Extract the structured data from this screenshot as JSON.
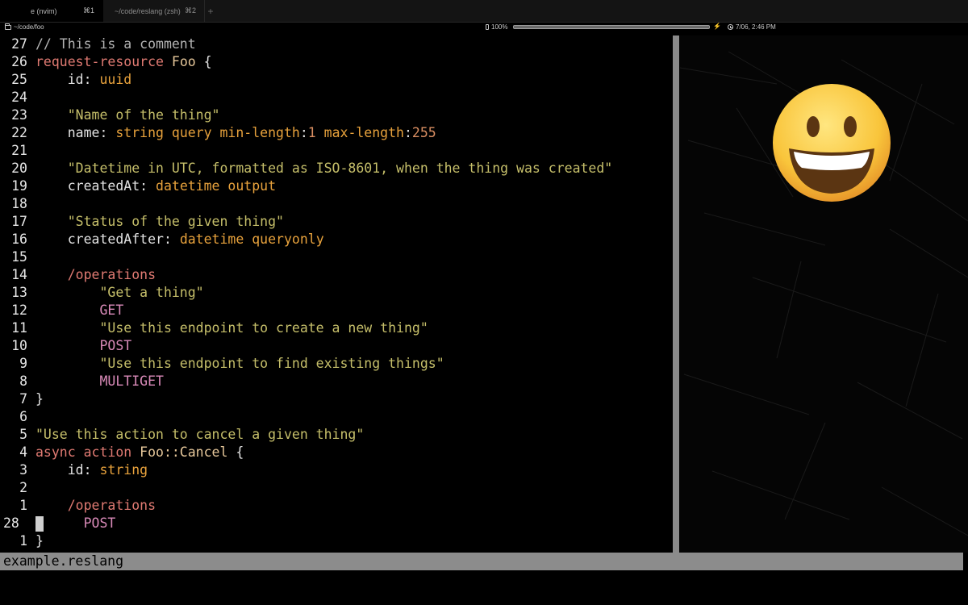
{
  "tabs": [
    {
      "title": "e (nvim)",
      "shortcut": "⌘1",
      "active": true
    },
    {
      "title": "~/code/reslang (zsh)",
      "shortcut": "⌘2",
      "active": false
    }
  ],
  "statusline": {
    "path": "~/code/foo",
    "battery": "100%",
    "battery_level": 1.0,
    "clock": "7/06, 2:46 PM"
  },
  "editor": {
    "filename": "example.reslang",
    "lines": [
      {
        "num": "27",
        "tokens": [
          {
            "t": "cmt",
            "v": "// This is a comment"
          }
        ]
      },
      {
        "num": "26",
        "tokens": [
          {
            "t": "kw",
            "v": "request-resource "
          },
          {
            "t": "name",
            "v": "Foo "
          },
          {
            "t": "punc",
            "v": "{"
          }
        ]
      },
      {
        "num": "25",
        "tokens": [
          {
            "t": "id",
            "v": "    id: "
          },
          {
            "t": "type",
            "v": "uuid"
          }
        ]
      },
      {
        "num": "24",
        "tokens": []
      },
      {
        "num": "23",
        "tokens": [
          {
            "t": "str",
            "v": "    \"Name of the thing\""
          }
        ]
      },
      {
        "num": "22",
        "tokens": [
          {
            "t": "id",
            "v": "    name: "
          },
          {
            "t": "type",
            "v": "string query min-length"
          },
          {
            "t": "id",
            "v": ":"
          },
          {
            "t": "num",
            "v": "1 "
          },
          {
            "t": "type",
            "v": "max-length"
          },
          {
            "t": "id",
            "v": ":"
          },
          {
            "t": "num",
            "v": "255"
          }
        ]
      },
      {
        "num": "21",
        "tokens": []
      },
      {
        "num": "20",
        "tokens": [
          {
            "t": "str",
            "v": "    \"Datetime in UTC, formatted as ISO-8601, when the thing was created\""
          }
        ]
      },
      {
        "num": "19",
        "tokens": [
          {
            "t": "id",
            "v": "    createdAt: "
          },
          {
            "t": "type",
            "v": "datetime output"
          }
        ]
      },
      {
        "num": "18",
        "tokens": []
      },
      {
        "num": "17",
        "tokens": [
          {
            "t": "str",
            "v": "    \"Status of the given thing\""
          }
        ]
      },
      {
        "num": "16",
        "tokens": [
          {
            "t": "id",
            "v": "    createdAfter: "
          },
          {
            "t": "type",
            "v": "datetime queryonly"
          }
        ]
      },
      {
        "num": "15",
        "tokens": []
      },
      {
        "num": "14",
        "tokens": [
          {
            "t": "path",
            "v": "    /operations"
          }
        ]
      },
      {
        "num": "13",
        "tokens": [
          {
            "t": "str",
            "v": "        \"Get a thing\""
          }
        ]
      },
      {
        "num": "12",
        "tokens": [
          {
            "t": "verb",
            "v": "        GET"
          }
        ]
      },
      {
        "num": "11",
        "tokens": [
          {
            "t": "str",
            "v": "        \"Use this endpoint to create a new thing\""
          }
        ]
      },
      {
        "num": "10",
        "tokens": [
          {
            "t": "verb",
            "v": "        POST"
          }
        ]
      },
      {
        "num": "9",
        "tokens": [
          {
            "t": "str",
            "v": "        \"Use this endpoint to find existing things\""
          }
        ]
      },
      {
        "num": "8",
        "tokens": [
          {
            "t": "verb",
            "v": "        MULTIGET"
          }
        ]
      },
      {
        "num": "7",
        "tokens": [
          {
            "t": "punc",
            "v": "}"
          }
        ]
      },
      {
        "num": "6",
        "tokens": []
      },
      {
        "num": "5",
        "tokens": [
          {
            "t": "str",
            "v": "\"Use this action to cancel a given thing\""
          }
        ]
      },
      {
        "num": "4",
        "tokens": [
          {
            "t": "kw",
            "v": "async action "
          },
          {
            "t": "name",
            "v": "Foo::Cancel "
          },
          {
            "t": "punc",
            "v": "{"
          }
        ]
      },
      {
        "num": "3",
        "tokens": [
          {
            "t": "id",
            "v": "    id: "
          },
          {
            "t": "type",
            "v": "string"
          }
        ]
      },
      {
        "num": "2",
        "tokens": []
      },
      {
        "num": "1",
        "tokens": [
          {
            "t": "path",
            "v": "    /operations"
          }
        ]
      },
      {
        "num": "28",
        "current": true,
        "tokens": [
          {
            "t": "verb",
            "v": "      POST"
          }
        ]
      },
      {
        "num": "1",
        "tokens": [
          {
            "t": "punc",
            "v": "}"
          }
        ]
      }
    ]
  },
  "colors": {
    "keyword": "#e07a72",
    "type": "#e8a23c",
    "string": "#c6bf6a",
    "statusbar_bg": "#8c8c8c",
    "scrollbar": "#8a8a8a"
  },
  "icons": {
    "folder": "folder-icon",
    "battery": "battery-icon",
    "bolt": "bolt-icon",
    "clock": "clock-icon",
    "emoji": "grinning-face-emoji"
  }
}
